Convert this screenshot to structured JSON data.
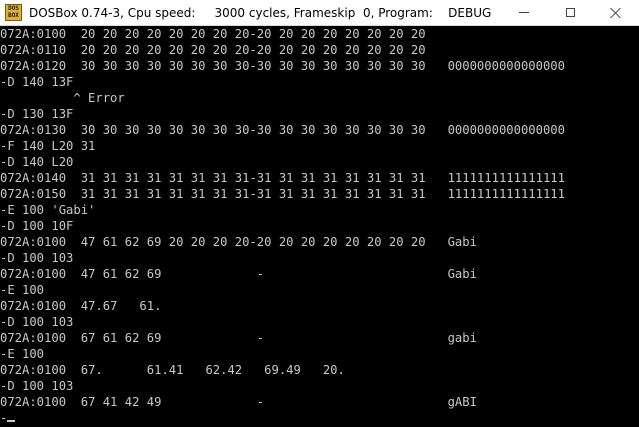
{
  "window": {
    "icon_text_top": "DOS",
    "icon_text_bottom": "BOX",
    "title": "DOSBox 0.74-3, Cpu speed:     3000 cycles, Frameskip  0, Program:    DEBUG",
    "minimize_label": "Minimize",
    "maximize_label": "Maximize",
    "close_label": "Close"
  },
  "colors": {
    "console_bg": "#000000",
    "console_fg": "#c8c8c8",
    "titlebar_bg": "#ffffff"
  },
  "console": {
    "lines": [
      "072A:0100  20 20 20 20 20 20 20 20-20 20 20 20 20 20 20 20",
      "072A:0110  20 20 20 20 20 20 20 20-20 20 20 20 20 20 20 20",
      "072A:0120  30 30 30 30 30 30 30 30-30 30 30 30 30 30 30 30   0000000000000000",
      "-D 140 13F",
      "          ^ Error",
      "-D 130 13F",
      "072A:0130  30 30 30 30 30 30 30 30-30 30 30 30 30 30 30 30   0000000000000000",
      "-F 140 L20 31",
      "-D 140 L20",
      "072A:0140  31 31 31 31 31 31 31 31-31 31 31 31 31 31 31 31   1111111111111111",
      "072A:0150  31 31 31 31 31 31 31 31-31 31 31 31 31 31 31 31   1111111111111111",
      "-E 100 'Gabi'",
      "-D 100 10F",
      "072A:0100  47 61 62 69 20 20 20 20-20 20 20 20 20 20 20 20   Gabi",
      "-D 100 103",
      "072A:0100  47 61 62 69             -                         Gabi",
      "-E 100",
      "072A:0100  47.67   61.",
      "-D 100 103",
      "072A:0100  67 61 62 69             -                         gabi",
      "-E 100",
      "072A:0100  67.      61.41   62.42   69.49   20.",
      "-D 100 103",
      "072A:0100  67 41 42 49             -                         gABI",
      "-"
    ]
  }
}
